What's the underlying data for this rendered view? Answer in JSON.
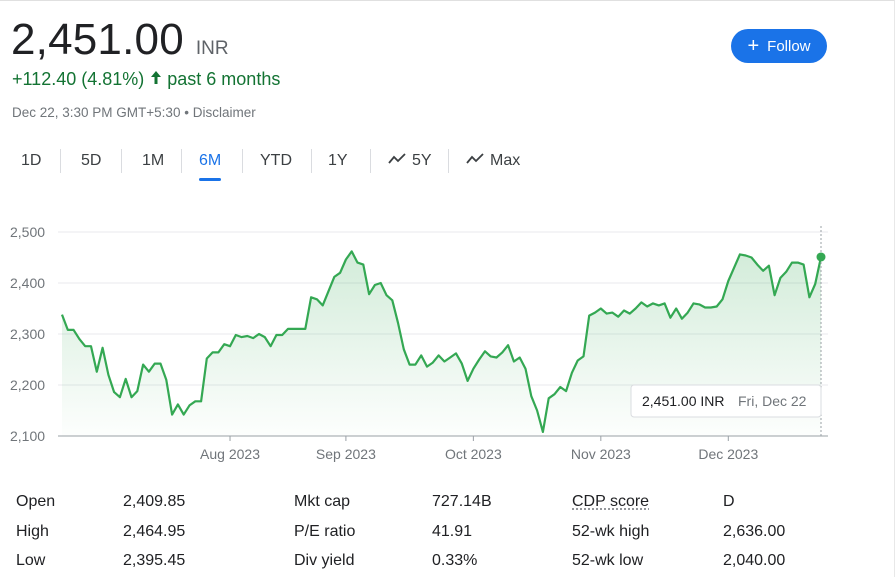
{
  "quote": {
    "price": "2,451.00",
    "currency": "INR",
    "change": "+112.40 (4.81%)",
    "period": "past 6 months",
    "timestamp": "Dec 22, 3:30 PM GMT+5:30",
    "separator": " • ",
    "disclaimer": "Disclaimer"
  },
  "follow_button": {
    "label": "Follow",
    "color": "#1a73e8"
  },
  "tabs": [
    {
      "label": "1D",
      "active": false
    },
    {
      "label": "5D",
      "active": false
    },
    {
      "label": "1M",
      "active": false
    },
    {
      "label": "6M",
      "active": true
    },
    {
      "label": "YTD",
      "active": false
    },
    {
      "label": "1Y",
      "active": false
    },
    {
      "label": "5Y",
      "active": false,
      "icon": "trend-icon"
    },
    {
      "label": "Max",
      "active": false,
      "icon": "trend-icon"
    }
  ],
  "colors": {
    "up": "#137333",
    "line": "#34a853",
    "fill": "#e6f4ea",
    "accent": "#1a73e8"
  },
  "chart_data": {
    "type": "area",
    "title": "",
    "xlabel": "",
    "ylabel": "",
    "ylim": [
      2100,
      2500
    ],
    "yticks": [
      "2,500",
      "2,400",
      "2,300",
      "2,200",
      "2,100"
    ],
    "xticks": [
      "Aug 2023",
      "Sep 2023",
      "Oct 2023",
      "Nov 2023",
      "Dec 2023"
    ],
    "grid": true,
    "series": [
      {
        "values": [
          2338,
          2308,
          2308,
          2290,
          2276,
          2276,
          2226,
          2273,
          2220,
          2186,
          2176,
          2212,
          2176,
          2188,
          2240,
          2226,
          2242,
          2242,
          2210,
          2142,
          2162,
          2142,
          2160,
          2168,
          2168,
          2252,
          2264,
          2264,
          2280,
          2276,
          2298,
          2294,
          2296,
          2292,
          2300,
          2294,
          2276,
          2298,
          2298,
          2310,
          2310,
          2310,
          2310,
          2372,
          2368,
          2356,
          2384,
          2412,
          2420,
          2446,
          2462,
          2440,
          2436,
          2378,
          2396,
          2400,
          2376,
          2366,
          2322,
          2270,
          2240,
          2240,
          2258,
          2236,
          2244,
          2258,
          2246,
          2254,
          2262,
          2242,
          2208,
          2232,
          2250,
          2266,
          2256,
          2254,
          2264,
          2278,
          2246,
          2254,
          2232,
          2178,
          2150,
          2108,
          2174,
          2182,
          2196,
          2188,
          2224,
          2248,
          2256,
          2336,
          2342,
          2350,
          2340,
          2342,
          2334,
          2346,
          2340,
          2350,
          2362,
          2354,
          2360,
          2356,
          2360,
          2332,
          2350,
          2330,
          2342,
          2360,
          2358,
          2352,
          2352,
          2354,
          2368,
          2404,
          2430,
          2456,
          2454,
          2450,
          2436,
          2424,
          2434,
          2376,
          2410,
          2422,
          2440,
          2440,
          2436,
          2372,
          2398,
          2451
        ]
      }
    ],
    "tooltip": {
      "value": "2,451.00 INR",
      "date": "Fri, Dec 22"
    }
  },
  "stats": [
    {
      "label": "Open",
      "value": "2,409.85"
    },
    {
      "label": "High",
      "value": "2,464.95"
    },
    {
      "label": "Low",
      "value": "2,395.45"
    },
    {
      "label": "Mkt cap",
      "value": "727.14B"
    },
    {
      "label": "P/E ratio",
      "value": "41.91"
    },
    {
      "label": "Div yield",
      "value": "0.33%"
    },
    {
      "label": "CDP score",
      "value": "D"
    },
    {
      "label": "52-wk high",
      "value": "2,636.00"
    },
    {
      "label": "52-wk low",
      "value": "2,040.00"
    }
  ]
}
